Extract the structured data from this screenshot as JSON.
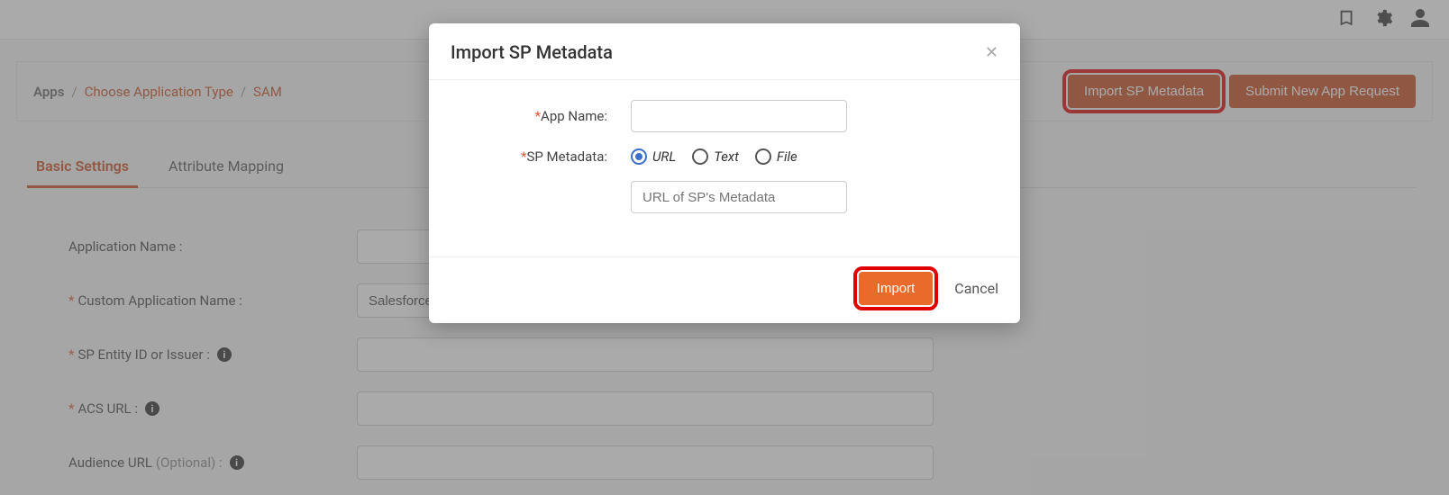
{
  "breadcrumbs": {
    "item1": "Apps",
    "item2": "Choose Application Type",
    "item3": "SAM"
  },
  "actions": {
    "import_sp_metadata": "Import SP Metadata",
    "submit_new_app": "Submit New App Request"
  },
  "tabs": {
    "basic_settings": "Basic Settings",
    "attribute_mapping": "Attribute Mapping"
  },
  "form": {
    "application_name": {
      "label": "Application Name :",
      "value": ""
    },
    "custom_app_name": {
      "label": "Custom Application Name :",
      "value": "Salesforce"
    },
    "sp_entity": {
      "label": "SP Entity ID or Issuer :",
      "value": ""
    },
    "acs_url": {
      "label": "ACS URL :",
      "value": ""
    },
    "audience_url": {
      "label": "Audience URL ",
      "optional": "(Optional) :",
      "value": ""
    }
  },
  "modal": {
    "title": "Import SP Metadata",
    "app_name_label": "App Name:",
    "sp_metadata_label": "SP Metadata:",
    "radio_url": "URL",
    "radio_text": "Text",
    "radio_file": "File",
    "url_placeholder": "URL of SP's Metadata",
    "import_btn": "Import",
    "cancel_btn": "Cancel"
  }
}
